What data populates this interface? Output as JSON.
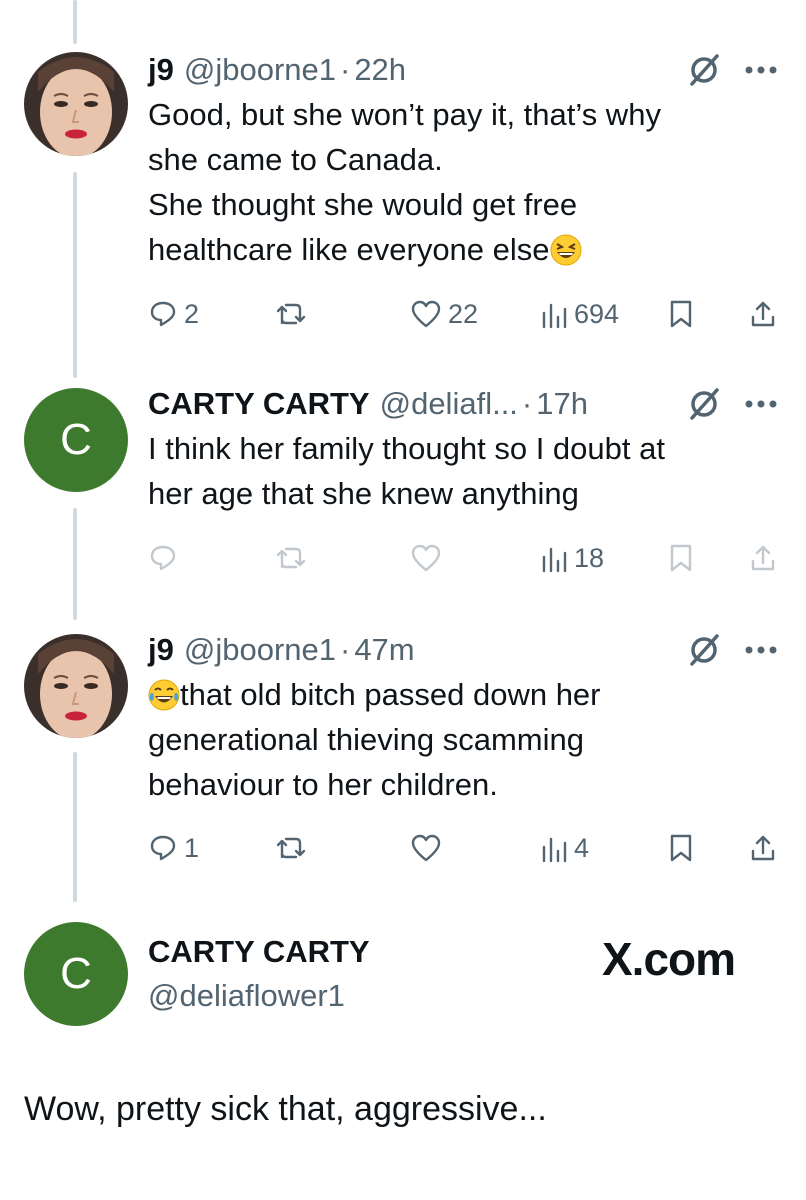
{
  "thread": [
    {
      "avatar": "portrait-avatar",
      "name": "j9",
      "handle": "@jboorne1",
      "time": "22h",
      "lines": [
        "Good, but she won’t pay it, that’s why",
        "she came to Canada.",
        "She thought she would get free",
        "healthcare like everyone else"
      ],
      "trailing_emoji": "grinning-squinting-face",
      "replies": "2",
      "reposts": "",
      "likes": "22",
      "views": "694"
    },
    {
      "avatar_letter": "C",
      "name": "CARTY CARTY",
      "handle": "@deliafl...",
      "time": "17h",
      "lines": [
        "I think her family thought so I doubt at",
        "her age that she knew anything"
      ],
      "replies": "",
      "reposts": "",
      "likes": "",
      "views": "18"
    },
    {
      "avatar": "portrait-avatar",
      "name": "j9",
      "handle": "@jboorne1",
      "time": "47m",
      "leading_emoji": "face-with-tears-of-joy",
      "lines": [
        "that old bitch passed down her",
        "generational thieving scamming",
        "behaviour to her children."
      ],
      "replies": "1",
      "reposts": "",
      "likes": "",
      "views": "4"
    }
  ],
  "profile_card": {
    "avatar_letter": "C",
    "name": "CARTY CARTY",
    "handle": "@deliaflower1",
    "brand": "X.com"
  },
  "caption": "Wow, pretty sick that, aggressive...",
  "colors": {
    "text": "#0f1419",
    "muted": "#536471",
    "thread_line": "#cfd9de",
    "avatar_green": "#3d7a2e"
  },
  "icons": [
    "reply-icon",
    "repost-icon",
    "like-icon",
    "views-icon",
    "bookmark-icon",
    "share-icon",
    "more-icon",
    "grok-icon"
  ]
}
